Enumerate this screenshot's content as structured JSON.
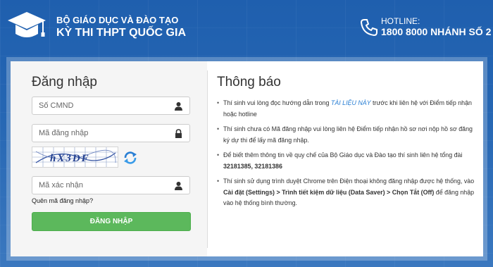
{
  "header": {
    "org": "BỘ GIÁO DỤC VÀ ĐÀO TẠO",
    "exam": "KỲ THI THPT QUỐC GIA",
    "hotline_label": "HOTLINE:",
    "hotline_number": "1800 8000 NHÁNH SỐ 2",
    "logo_icon": "graduation-cap-icon",
    "phone_icon": "phone-icon"
  },
  "login": {
    "title": "Đăng nhập",
    "cmnd_placeholder": "Số CMND",
    "code_placeholder": "Mã đăng nhập",
    "captcha_text": "hX3DF",
    "verify_placeholder": "Mã xác nhận",
    "forgot": "Quên mã đăng nhập?",
    "submit": "ĐĂNG NHẬP",
    "button_color": "#5cb85c"
  },
  "notice": {
    "title": "Thông báo",
    "items": [
      {
        "before": "Thí sinh vui lòng đọc hướng dẫn trong ",
        "link": "TÀI LIỆU NÀY",
        "after": " trước khi liên hệ với Điểm tiếp nhận hoặc hotline"
      },
      {
        "text": "Thí sinh chưa có Mã đăng nhập vui lòng liên hệ Điểm tiếp nhận hồ sơ nơi nộp hồ sơ đăng ký dự thi để lấy mã đăng nhập."
      },
      {
        "text": "Để biết thêm thông tin về quy chế của Bộ Giáo dục và Đào tạo thí sinh liên hệ tổng đài ",
        "bold": "32181385, 32181386"
      },
      {
        "before": "Thí sinh sử dụng trình duyệt Chrome trên Điện thoại không đăng nhập được hệ thống, vào ",
        "bold": "Cài đặt (Settings) > Trình tiết kiệm dữ liệu (Data Saver) > Chọn Tắt (Off)",
        "after": " để đăng nhập vào hệ thống bình thường."
      }
    ]
  }
}
